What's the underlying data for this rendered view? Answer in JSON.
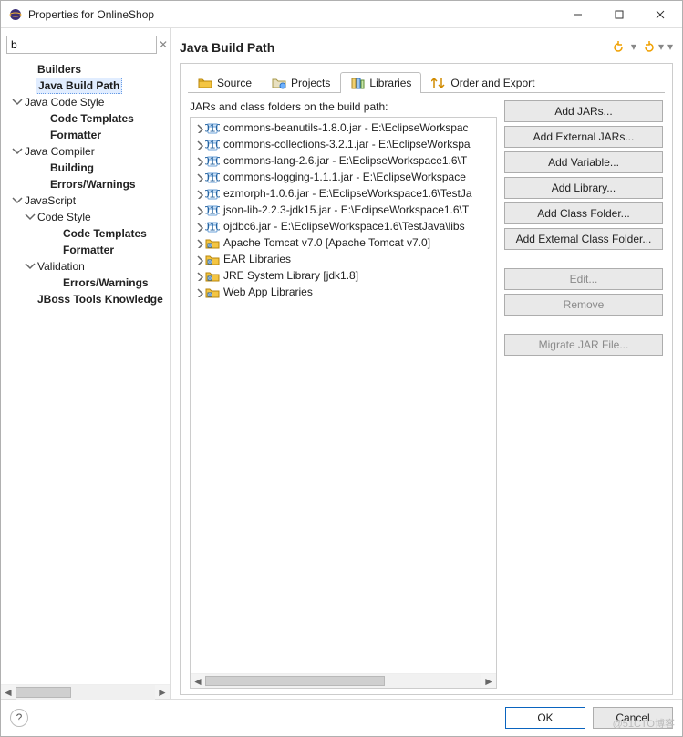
{
  "titlebar": {
    "title": "Properties for OnlineShop"
  },
  "filter": {
    "value": "b",
    "clear_glyph": "✕"
  },
  "tree": [
    {
      "label": "Builders",
      "indent": 1,
      "bold": true,
      "twisty": "",
      "sel": false,
      "hi": false
    },
    {
      "label": "Java Build Path",
      "indent": 1,
      "bold": true,
      "twisty": "",
      "sel": false,
      "hi": true
    },
    {
      "label": "Java Code Style",
      "indent": 0,
      "bold": false,
      "twisty": "v",
      "sel": false,
      "hi": false
    },
    {
      "label": "Code Templates",
      "indent": 2,
      "bold": true,
      "twisty": "",
      "sel": false,
      "hi": false
    },
    {
      "label": "Formatter",
      "indent": 2,
      "bold": true,
      "twisty": "",
      "sel": false,
      "hi": false
    },
    {
      "label": "Java Compiler",
      "indent": 0,
      "bold": false,
      "twisty": "v",
      "sel": false,
      "hi": false
    },
    {
      "label": "Building",
      "indent": 2,
      "bold": true,
      "twisty": "",
      "sel": false,
      "hi": false
    },
    {
      "label": "Errors/Warnings",
      "indent": 2,
      "bold": true,
      "twisty": "",
      "sel": false,
      "hi": false
    },
    {
      "label": "JavaScript",
      "indent": 0,
      "bold": false,
      "twisty": "v",
      "sel": false,
      "hi": false
    },
    {
      "label": "Code Style",
      "indent": 1,
      "bold": false,
      "twisty": "v",
      "sel": false,
      "hi": false
    },
    {
      "label": "Code Templates",
      "indent": 3,
      "bold": true,
      "twisty": "",
      "sel": false,
      "hi": false
    },
    {
      "label": "Formatter",
      "indent": 3,
      "bold": true,
      "twisty": "",
      "sel": false,
      "hi": false
    },
    {
      "label": "Validation",
      "indent": 1,
      "bold": false,
      "twisty": "v",
      "sel": false,
      "hi": false
    },
    {
      "label": "Errors/Warnings",
      "indent": 3,
      "bold": true,
      "twisty": "",
      "sel": false,
      "hi": false
    },
    {
      "label": "JBoss Tools Knowledge",
      "indent": 1,
      "bold": true,
      "twisty": "",
      "sel": false,
      "hi": false
    }
  ],
  "heading": "Java Build Path",
  "tabs": [
    {
      "name": "source",
      "label": "Source",
      "active": false,
      "icon": "source"
    },
    {
      "name": "projects",
      "label": "Projects",
      "active": false,
      "icon": "projects"
    },
    {
      "name": "libraries",
      "label": "Libraries",
      "active": true,
      "icon": "libraries"
    },
    {
      "name": "order",
      "label": "Order and Export",
      "active": false,
      "icon": "order"
    }
  ],
  "list_label": "JARs and class folders on the build path:",
  "jars": [
    {
      "icon": "jar",
      "label": "commons-beanutils-1.8.0.jar - E:\\EclipseWorkspac"
    },
    {
      "icon": "jar",
      "label": "commons-collections-3.2.1.jar - E:\\EclipseWorkspa"
    },
    {
      "icon": "jar",
      "label": "commons-lang-2.6.jar - E:\\EclipseWorkspace1.6\\T"
    },
    {
      "icon": "jar",
      "label": "commons-logging-1.1.1.jar - E:\\EclipseWorkspace"
    },
    {
      "icon": "jar",
      "label": "ezmorph-1.0.6.jar - E:\\EclipseWorkspace1.6\\TestJa"
    },
    {
      "icon": "jar",
      "label": "json-lib-2.2.3-jdk15.jar - E:\\EclipseWorkspace1.6\\T"
    },
    {
      "icon": "jar",
      "label": "ojdbc6.jar - E:\\EclipseWorkspace1.6\\TestJava\\libs"
    },
    {
      "icon": "lib",
      "label": "Apache Tomcat v7.0 [Apache Tomcat v7.0]"
    },
    {
      "icon": "lib",
      "label": "EAR Libraries"
    },
    {
      "icon": "lib",
      "label": "JRE System Library [jdk1.8]"
    },
    {
      "icon": "lib",
      "label": "Web App Libraries"
    }
  ],
  "buttons": {
    "add_jars": {
      "label": "Add JARs...",
      "disabled": false
    },
    "add_ext_jars": {
      "label": "Add External JARs...",
      "disabled": false
    },
    "add_variable": {
      "label": "Add Variable...",
      "disabled": false
    },
    "add_library": {
      "label": "Add Library...",
      "disabled": false
    },
    "add_class_folder": {
      "label": "Add Class Folder...",
      "disabled": false
    },
    "add_ext_folder": {
      "label": "Add External Class Folder...",
      "disabled": false
    },
    "edit": {
      "label": "Edit...",
      "disabled": true
    },
    "remove": {
      "label": "Remove",
      "disabled": true
    },
    "migrate": {
      "label": "Migrate JAR File...",
      "disabled": true
    }
  },
  "footer": {
    "ok": "OK",
    "cancel": "Cancel",
    "help": "?"
  },
  "watermark": "@51CTO博客"
}
